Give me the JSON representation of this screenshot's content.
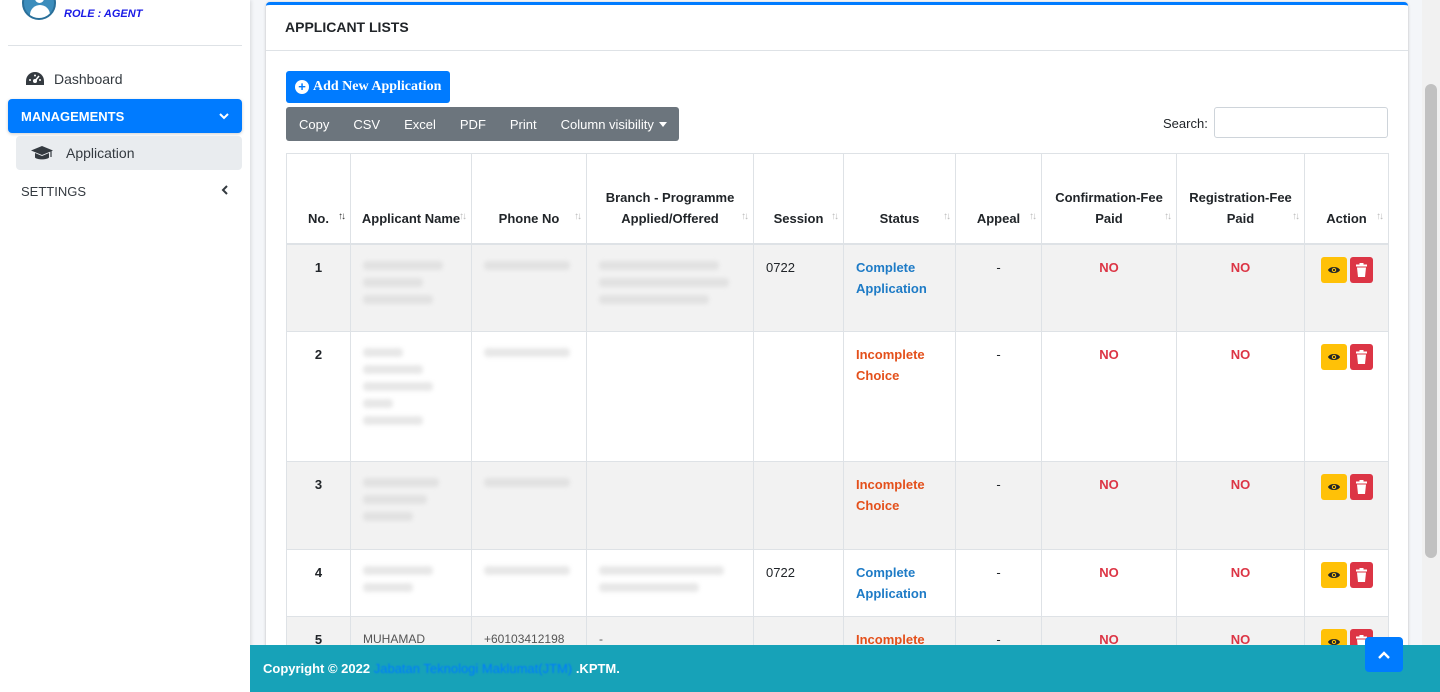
{
  "sidebar": {
    "role": "ROLE : AGENT",
    "items": [
      {
        "label": "Dashboard",
        "icon": "tachometer-icon"
      },
      {
        "label": "MANAGEMENTS",
        "icon": "chevron-down-icon"
      },
      {
        "label": "Application",
        "icon": "graduation-cap-icon"
      },
      {
        "label": "SETTINGS",
        "icon": "chevron-left-icon"
      }
    ]
  },
  "main": {
    "title": "APPLICANT LISTS",
    "add_button": "Add New Application",
    "export_buttons": [
      "Copy",
      "CSV",
      "Excel",
      "PDF",
      "Print",
      "Column visibility"
    ],
    "search_label": "Search:",
    "search_value": "",
    "table": {
      "columns": [
        "No.",
        "Applicant Name",
        "Phone No",
        "Branch - Programme Applied/Offered",
        "Session",
        "Status",
        "Appeal",
        "Confirmation-Fee Paid",
        "Registration-Fee Paid",
        "Action"
      ],
      "sorted_column": "No.",
      "rows": [
        {
          "no": "1",
          "session": "0722",
          "status": "Complete Application",
          "status_type": "complete",
          "appeal": "-",
          "confirmation": "NO",
          "registration": "NO"
        },
        {
          "no": "2",
          "session": "",
          "status": "Incomplete Choice",
          "status_type": "incomplete",
          "appeal": "-",
          "confirmation": "NO",
          "registration": "NO"
        },
        {
          "no": "3",
          "session": "",
          "status": "Incomplete Choice",
          "status_type": "incomplete",
          "appeal": "-",
          "confirmation": "NO",
          "registration": "NO"
        },
        {
          "no": "4",
          "session": "0722",
          "status": "Complete Application",
          "status_type": "complete",
          "appeal": "-",
          "confirmation": "NO",
          "registration": "NO"
        },
        {
          "no": "5",
          "name": "MUHAMAD",
          "phone": "+60103412198",
          "branch": "-",
          "session": "",
          "status": "Incomplete",
          "status_type": "incomplete",
          "appeal": "-",
          "confirmation": "NO",
          "registration": "NO"
        }
      ]
    }
  },
  "footer": {
    "prefix": "Copyright © 2022",
    "link": "Jabatan Teknologi Maklumat(JTM)",
    "suffix": ".KPTM."
  },
  "colors": {
    "primary": "#007bff",
    "footer": "#17a2b8",
    "complete": "#1e7bc6",
    "incomplete": "#e4501b",
    "no": "#dc3545"
  }
}
